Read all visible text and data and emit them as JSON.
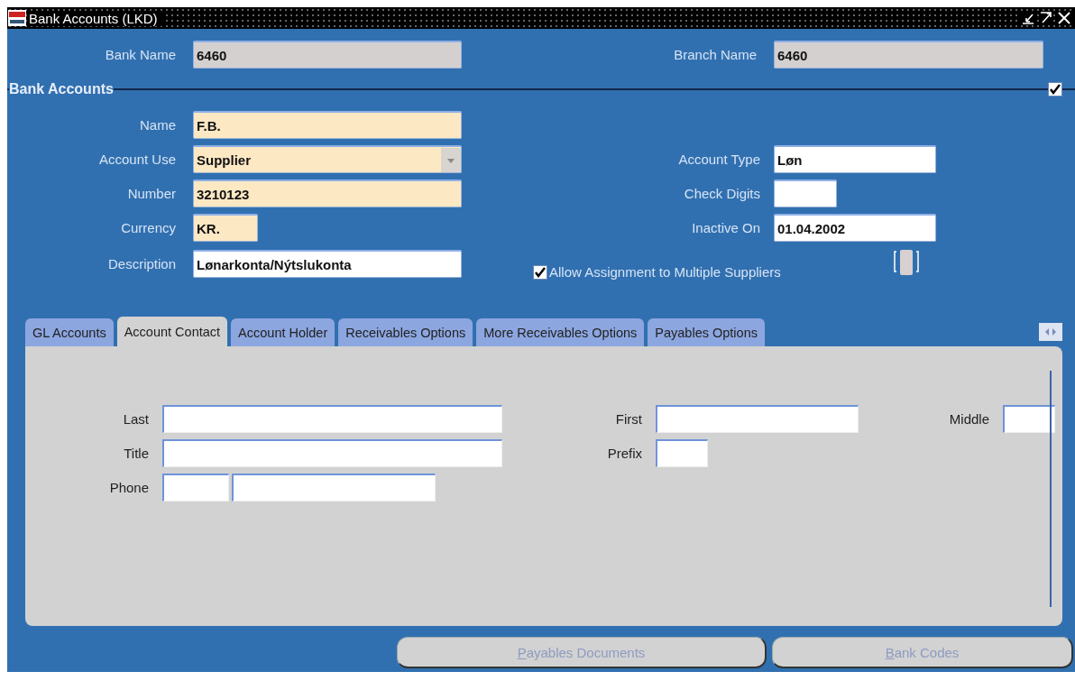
{
  "window": {
    "title": "Bank Accounts (LKD)"
  },
  "header": [
    {
      "label": "Bank Name",
      "value": "6460"
    },
    {
      "label": "Branch Name",
      "value": "6460"
    }
  ],
  "bank_accounts": {
    "title": "Bank Accounts",
    "checked": true,
    "left_fields": [
      {
        "label": "Name",
        "value": "F.B.",
        "kind": "required"
      },
      {
        "label": "Account Use",
        "value": "Supplier",
        "kind": "dropdown"
      },
      {
        "label": "Number",
        "value": "3210123",
        "kind": "required"
      },
      {
        "label": "Currency",
        "value": "KR.",
        "kind": "required-short"
      },
      {
        "label": "Description",
        "value": "Lønarkonta/Nýtslukonta",
        "kind": "text"
      }
    ],
    "right_fields": [
      {
        "label": "Account Type",
        "value": "Løn",
        "kind": "text"
      },
      {
        "label": "Check Digits",
        "kind": "short"
      },
      {
        "label": "Inactive On",
        "value": "01.04.2002",
        "kind": "text"
      }
    ],
    "allow_multiple": {
      "label": "Allow Assignment to Multiple Suppliers",
      "checked": true
    }
  },
  "tabs": [
    {
      "label": "GL Accounts",
      "selected": false
    },
    {
      "label": "Account Contact",
      "selected": true
    },
    {
      "label": "Account Holder",
      "selected": false
    },
    {
      "label": "Receivables Options",
      "selected": false
    },
    {
      "label": "More Receivables Options",
      "selected": false
    },
    {
      "label": "Payables Options",
      "selected": false
    }
  ],
  "contact": {
    "rows": [
      {
        "fields": [
          {
            "label": "Last",
            "kind": "long"
          },
          {
            "label": "First",
            "kind": "medium"
          },
          {
            "label": "Middle",
            "kind": "short"
          }
        ]
      },
      {
        "fields": [
          {
            "label": "Title",
            "kind": "long"
          },
          {
            "label": "Prefix",
            "kind": "short"
          }
        ]
      },
      {
        "fields": [
          {
            "label": "Phone",
            "kind": "phone"
          }
        ]
      }
    ]
  },
  "buttons": [
    {
      "label": "Payables Documents",
      "disabled": true
    },
    {
      "label": "Bank Codes",
      "disabled": true
    }
  ]
}
